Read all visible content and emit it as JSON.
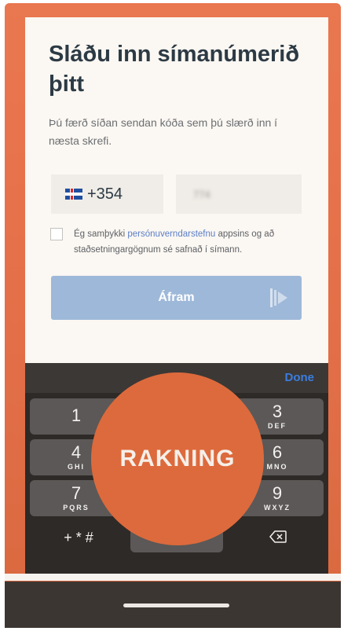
{
  "screen": {
    "title": "Sláðu inn símanúmerið þitt",
    "subtitle": "Þú færð síðan sendan kóða sem þú slærð inn í næsta skrefi."
  },
  "phone_input": {
    "country_code": "+354",
    "flag_icon": "iceland-flag-icon",
    "number_value": "774"
  },
  "consent": {
    "checked": false,
    "text_before": "Ég samþykki ",
    "link_text": "persónuverndarstefnu",
    "text_after": " appsins og að staðsetningargögnum sé safnað í símann."
  },
  "continue_button": {
    "label": "Áfram",
    "icon": "forward-arrow-icon"
  },
  "keyboard": {
    "done_label": "Done",
    "keys": [
      {
        "num": "1",
        "letters": ""
      },
      {
        "num": "3",
        "letters": "DEF"
      },
      {
        "num": "4",
        "letters": "GHI"
      },
      {
        "num": "6",
        "letters": "MNO"
      },
      {
        "num": "7",
        "letters": "PQRS"
      },
      {
        "num": "9",
        "letters": "WXYZ"
      }
    ],
    "symbols_label": "+ * #",
    "delete_icon": "backspace-icon"
  },
  "overlay": {
    "text": "RAKNING"
  },
  "colors": {
    "accent_orange": "#dd6a3c",
    "button_blue": "#9eb8d9",
    "link_blue": "#5b7fc7",
    "done_blue": "#3a7de0"
  }
}
